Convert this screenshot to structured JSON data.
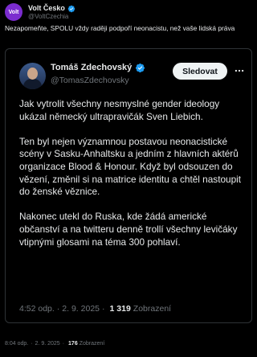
{
  "author": {
    "name": "Volt Česko",
    "handle": "@VoltCzechia",
    "avatar_text": "Volt",
    "avatar_color": "#7b2ccf"
  },
  "post": {
    "text": "Nezapomeňte, SPOLU vždy raději podpoří neonacistu, než vaše lidská práva"
  },
  "quoted": {
    "name": "Tomáš Zdechovský",
    "handle": "@TomasZdechovsky",
    "follow_label": "Sledovat",
    "more_icon": "more-icon",
    "body": "Jak vytrolit všechny nesmyslné gender ideology ukázal německý ultrapravičák Sven Liebich.\n\nTen byl nejen významnou postavou neonacistické scény v Sasku-Anhaltsku a jedním z hlavních aktérů organizace Blood & Honour. Když byl odsouzen do vězení, změnil si na matrice identitu a chtěl nastoupit do ženské věznice.\n\nNakonec utekl do Ruska, kde žádá americké občanství a na twitteru denně trollí všechny levičáky vtipnými glosami na téma 300 pohlaví.",
    "time": "4:52 odp.",
    "date": "2. 9. 2025",
    "views": "1 319",
    "views_label": "Zobrazení"
  },
  "footer": {
    "time": "8:04 odp.",
    "date": "2. 9. 2025",
    "views": "176",
    "views_label": "Zobrazení"
  },
  "colors": {
    "background": "#000000",
    "text": "#e7e9ea",
    "muted": "#71767b",
    "verified_blue": "#1d9bf0",
    "border": "#2f3336"
  }
}
